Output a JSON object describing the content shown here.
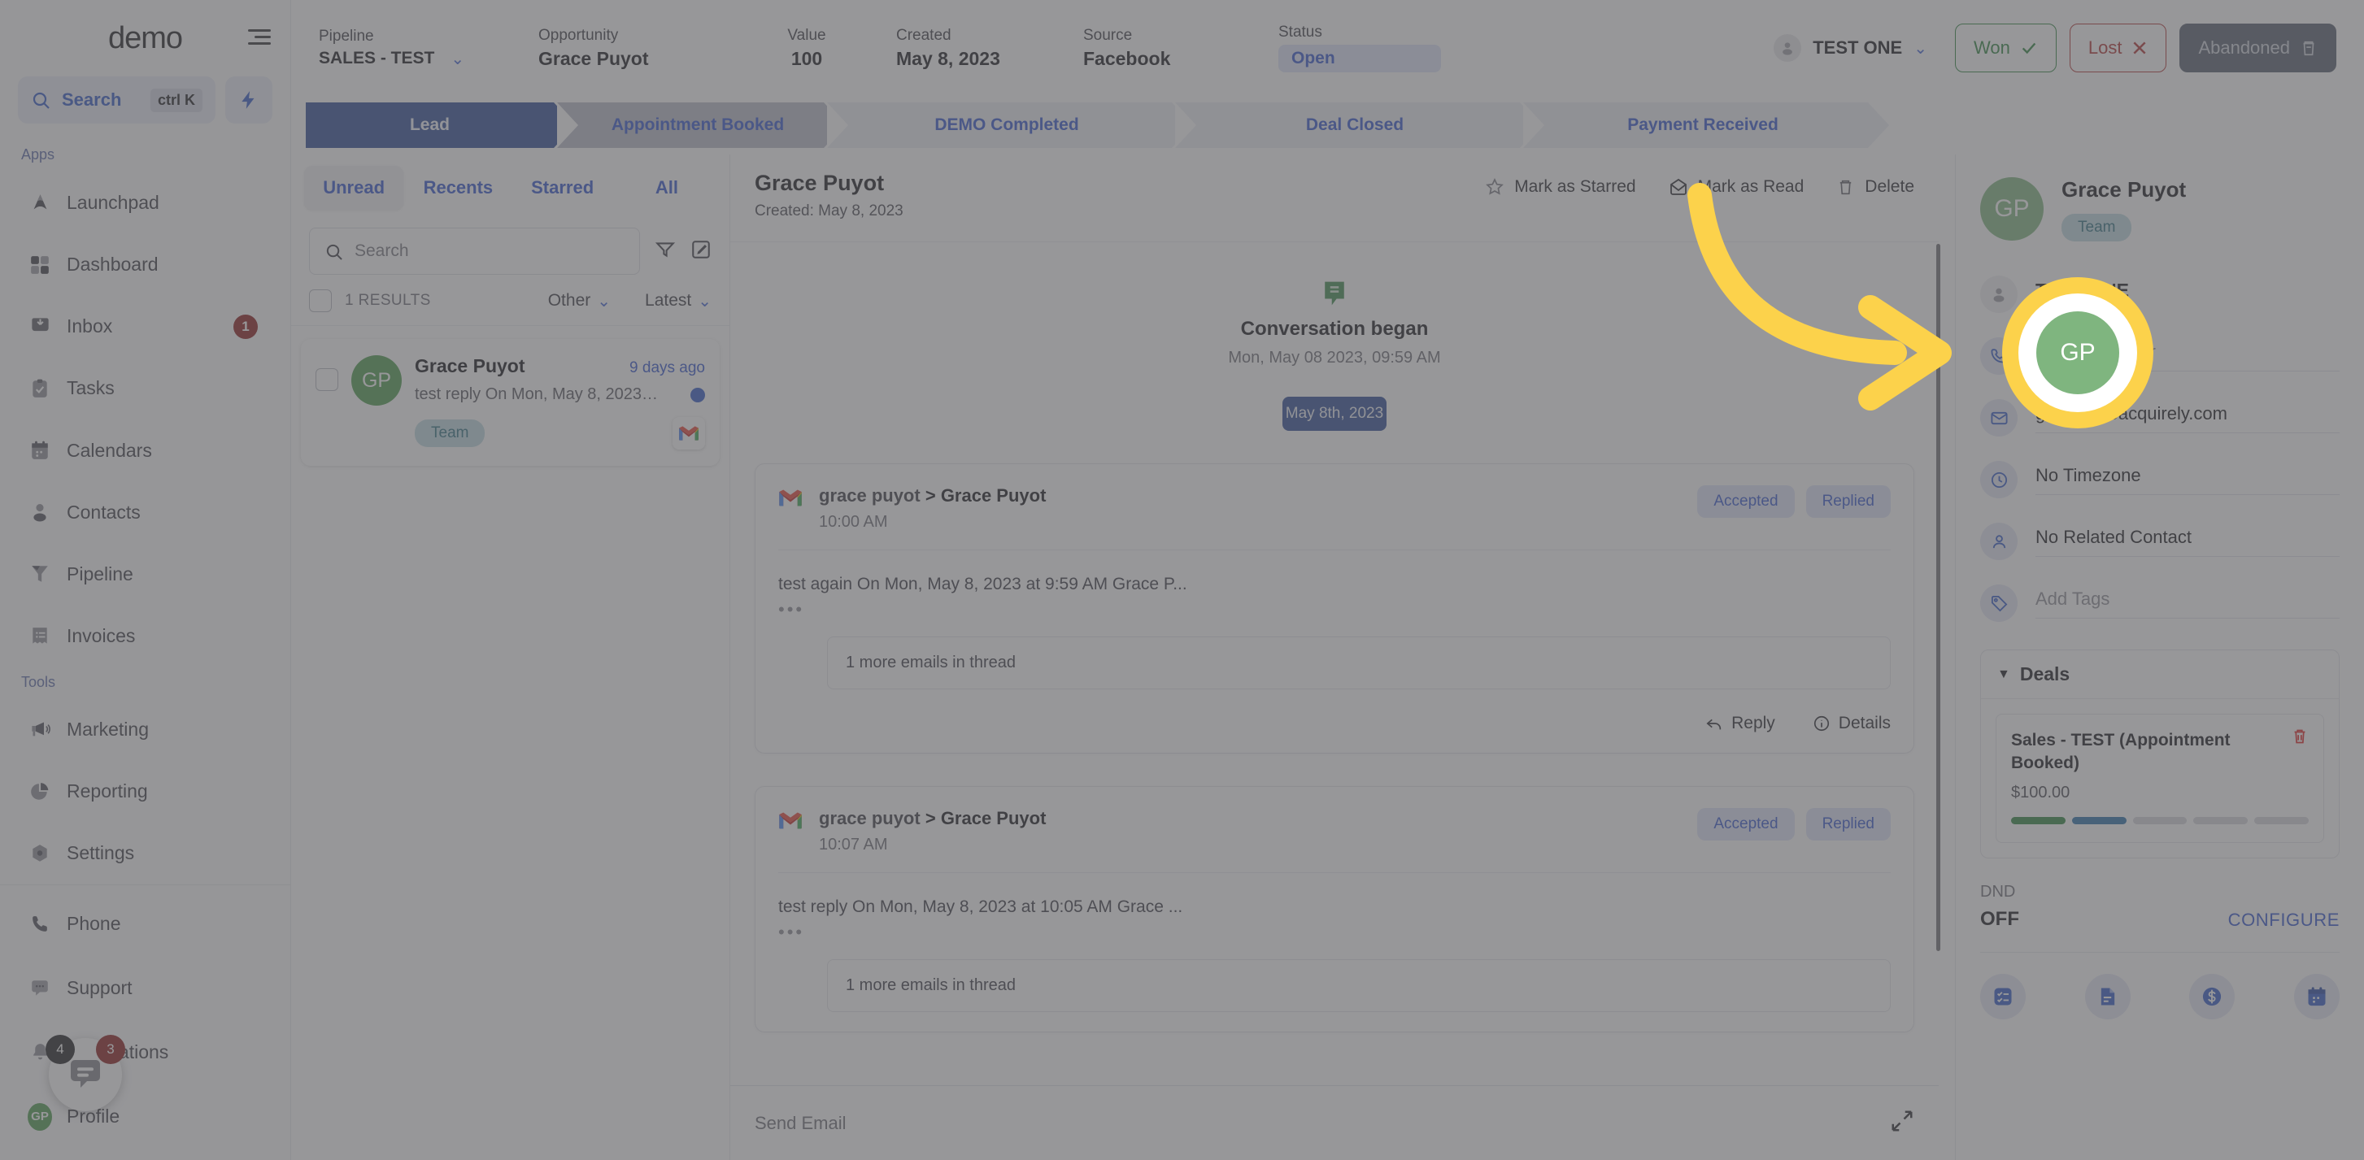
{
  "sidebar": {
    "logo": "demo",
    "search": {
      "label": "Search",
      "kbd": "ctrl K"
    },
    "sections": [
      {
        "label": "Apps"
      },
      {
        "label": "Tools"
      }
    ],
    "apps": [
      {
        "label": "Launchpad",
        "icon": "launchpad-icon",
        "badge": ""
      },
      {
        "label": "Dashboard",
        "icon": "dashboard-icon",
        "badge": ""
      },
      {
        "label": "Inbox",
        "icon": "inbox-icon",
        "badge": "1"
      },
      {
        "label": "Tasks",
        "icon": "tasks-icon",
        "badge": ""
      },
      {
        "label": "Calendars",
        "icon": "calendar-icon",
        "badge": ""
      },
      {
        "label": "Contacts",
        "icon": "contacts-icon",
        "badge": ""
      },
      {
        "label": "Pipeline",
        "icon": "funnel-icon",
        "badge": ""
      },
      {
        "label": "Invoices",
        "icon": "invoice-icon",
        "badge": ""
      }
    ],
    "tools": [
      {
        "label": "Marketing",
        "icon": "megaphone-icon"
      },
      {
        "label": "Reporting",
        "icon": "pie-chart-icon"
      },
      {
        "label": "Settings",
        "icon": "gear-icon"
      }
    ],
    "bottom": [
      {
        "label": "Phone",
        "icon": "phone-icon"
      },
      {
        "label": "Support",
        "icon": "chat-bubble-icon"
      },
      {
        "label": "Notifications",
        "icon": "bell-icon"
      },
      {
        "label": "Profile",
        "icon": "avatar-icon",
        "initials": "GP"
      }
    ]
  },
  "header": {
    "fields": [
      {
        "key": "Pipeline",
        "value": "SALES - TEST"
      },
      {
        "key": "Opportunity",
        "value": "Grace Puyot"
      },
      {
        "key": "Value",
        "value": "100"
      },
      {
        "key": "Created",
        "value": "May 8, 2023"
      },
      {
        "key": "Source",
        "value": "Facebook"
      },
      {
        "key": "Status",
        "value": "Open"
      }
    ],
    "owner": "TEST ONE",
    "buttons": {
      "won": "Won",
      "lost": "Lost",
      "abandoned": "Abandoned"
    }
  },
  "stages": [
    {
      "label": "Lead",
      "state": "active"
    },
    {
      "label": "Appointment Booked",
      "state": "next"
    },
    {
      "label": "DEMO Completed",
      "state": "idle"
    },
    {
      "label": "Deal Closed",
      "state": "idle"
    },
    {
      "label": "Payment Received",
      "state": "idle"
    }
  ],
  "conversation_list": {
    "tabs": [
      {
        "label": "Unread",
        "active": true
      },
      {
        "label": "Recents",
        "active": false
      },
      {
        "label": "Starred",
        "active": false
      },
      {
        "label": "All",
        "active": false
      }
    ],
    "search_placeholder": "Search",
    "results_count": "1 RESULTS",
    "filter_type": "Other",
    "sort": "Latest",
    "items": [
      {
        "initials": "GP",
        "name": "Grace Puyot",
        "time": "9 days ago",
        "preview": "test reply On Mon, May 8, 2023 at ...",
        "tag": "Team",
        "channel": "gmail-icon",
        "unread": true
      }
    ]
  },
  "main": {
    "title": "Grace Puyot",
    "subtitle": "Created: May 8, 2023",
    "actions": [
      {
        "label": "Mark as Starred",
        "icon": "star-icon"
      },
      {
        "label": "Mark as Read",
        "icon": "open-envelope-icon"
      },
      {
        "label": "Delete",
        "icon": "trash-icon"
      }
    ],
    "conversation_began": {
      "title": "Conversation began",
      "timestamp": "Mon, May 08 2023, 09:59 AM"
    },
    "date_chip": "May 8th, 2023",
    "messages": [
      {
        "channel": "gmail-icon",
        "from": "grace puyot",
        "separator": ">",
        "to": "Grace Puyot",
        "time": "10:00 AM",
        "pills": [
          "Accepted",
          "Replied"
        ],
        "body": "test again On Mon, May 8, 2023 at 9:59 AM Grace P...",
        "thread_more": "1 more emails in thread",
        "footer": [
          {
            "label": "Reply",
            "icon": "reply-icon"
          },
          {
            "label": "Details",
            "icon": "info-icon"
          }
        ]
      },
      {
        "channel": "gmail-icon",
        "from": "grace puyot",
        "separator": ">",
        "to": "Grace Puyot",
        "time": "10:07 AM",
        "pills": [
          "Accepted",
          "Replied"
        ],
        "body": "test reply On Mon, May 8, 2023 at 10:05 AM Grace ...",
        "thread_more": "1 more emails in thread",
        "footer": []
      }
    ],
    "compose_placeholder": "Send Email"
  },
  "contact_panel": {
    "avatar_initials": "GP",
    "name": "Grace Puyot",
    "tag": "Team",
    "owner": "TEST ONE",
    "phone_placeholder": "Phone Number",
    "email": "grace@goacquirely.com",
    "timezone": "No Timezone",
    "related_contact": "No Related Contact",
    "tags_placeholder": "Add Tags",
    "deals": {
      "title": "Deals",
      "items": [
        {
          "title": "Sales - TEST (Appointment Booked)",
          "amount": "$100.00",
          "progress_segments": [
            "green",
            "blue",
            "grey",
            "grey",
            "grey"
          ]
        }
      ]
    },
    "dnd": {
      "label": "DND",
      "value": "OFF",
      "action": "CONFIGURE"
    },
    "quick_actions": [
      {
        "icon": "task-list-icon"
      },
      {
        "icon": "document-icon"
      },
      {
        "icon": "dollar-icon"
      },
      {
        "icon": "calendar-icon"
      }
    ]
  },
  "chat_widget": {
    "badge_dark": "4",
    "badge_red": "3"
  },
  "colors": {
    "accent_blue": "#3355cd",
    "stage_active": "#2c4a95",
    "green_avatar": "#4e9a4e",
    "highlight_yellow": "#fcd24b",
    "won_green": "#2e8540",
    "lost_red": "#b03232"
  }
}
